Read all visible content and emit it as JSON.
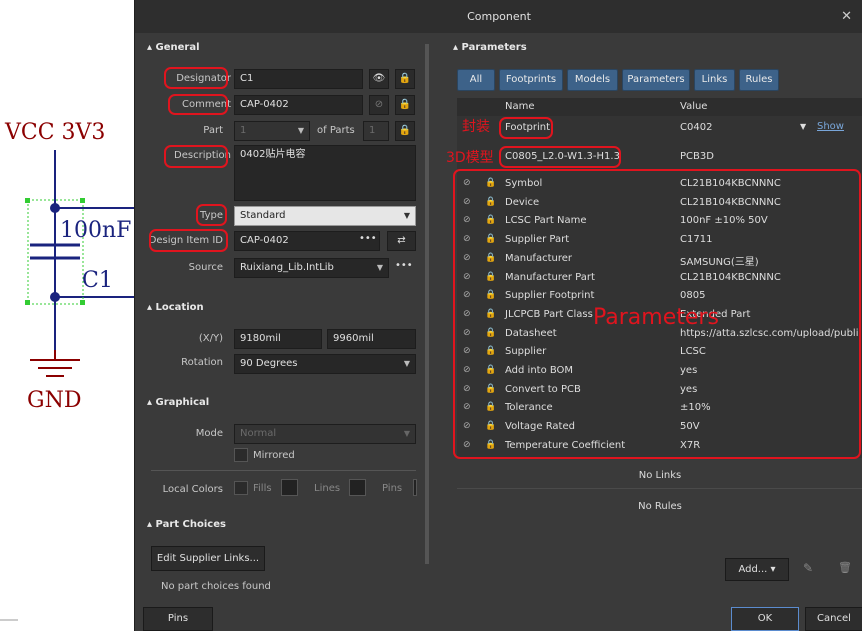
{
  "schematic": {
    "net": "VCC 3V3",
    "value": "100nF",
    "designator": "C1",
    "ground": "GND"
  },
  "dialog": {
    "title": "Component",
    "close_icon": "close-icon",
    "general": {
      "section": "General",
      "designator_label": "Designator",
      "designator_value": "C1",
      "comment_label": "Comment",
      "comment_value": "CAP-0402",
      "part_label": "Part",
      "part_value": "1",
      "of_parts_label": "of Parts",
      "of_parts_value": "1",
      "description_label": "Description",
      "description_value": "0402贴片电容",
      "type_label": "Type",
      "type_value": "Standard",
      "design_item_label": "Design Item ID",
      "design_item_value": "CAP-0402",
      "source_label": "Source",
      "source_value": "Ruixiang_Lib.IntLib"
    },
    "location": {
      "section": "Location",
      "xy_label": "(X/Y)",
      "x_value": "9180mil",
      "y_value": "9960mil",
      "rotation_label": "Rotation",
      "rotation_value": "90 Degrees"
    },
    "graphical": {
      "section": "Graphical",
      "mode_label": "Mode",
      "mode_value": "Normal",
      "mirrored_label": "Mirrored",
      "local_colors_label": "Local Colors",
      "fills_label": "Fills",
      "lines_label": "Lines",
      "pins_label": "Pins"
    },
    "part_choices": {
      "section": "Part Choices",
      "edit_button": "Edit Supplier Links...",
      "status": "No part choices found"
    },
    "parameters": {
      "section": "Parameters",
      "filters": [
        "All",
        "Footprints",
        "Models",
        "Parameters",
        "Links",
        "Rules"
      ],
      "col_name": "Name",
      "col_value": "Value",
      "footprint_name": "Footprint",
      "footprint_value": "C0402",
      "footprint_show": "Show",
      "model_name": "C0805_L2.0-W1.3-H1.3",
      "model_value": "PCB3D",
      "rows": [
        {
          "name": "Symbol",
          "value": "CL21B104KBCNNNC"
        },
        {
          "name": "Device",
          "value": "CL21B104KBCNNNC"
        },
        {
          "name": "LCSC Part Name",
          "value": "100nF ±10% 50V"
        },
        {
          "name": "Supplier Part",
          "value": "C1711"
        },
        {
          "name": "Manufacturer",
          "value": "SAMSUNG(三星)"
        },
        {
          "name": "Manufacturer Part",
          "value": "CL21B104KBCNNNC"
        },
        {
          "name": "Supplier Footprint",
          "value": "0805"
        },
        {
          "name": "JLCPCB Part Class",
          "value": "Extended Part"
        },
        {
          "name": "Datasheet",
          "value": "https://atta.szlcsc.com/upload/publi..."
        },
        {
          "name": "Supplier",
          "value": "LCSC"
        },
        {
          "name": "Add into BOM",
          "value": "yes"
        },
        {
          "name": "Convert to PCB",
          "value": "yes"
        },
        {
          "name": "Tolerance",
          "value": "±10%"
        },
        {
          "name": "Voltage Rated",
          "value": "50V"
        },
        {
          "name": "Temperature Coefficient",
          "value": "X7R"
        }
      ],
      "no_links": "No Links",
      "no_rules": "No Rules",
      "add_button": "Add..."
    },
    "annotations": {
      "footprint": "封装",
      "model3d": "3D模型",
      "parameters": "Parameters"
    },
    "footer": {
      "pins_button": "Pins",
      "ok_button": "OK",
      "cancel_button": "Cancel"
    }
  }
}
